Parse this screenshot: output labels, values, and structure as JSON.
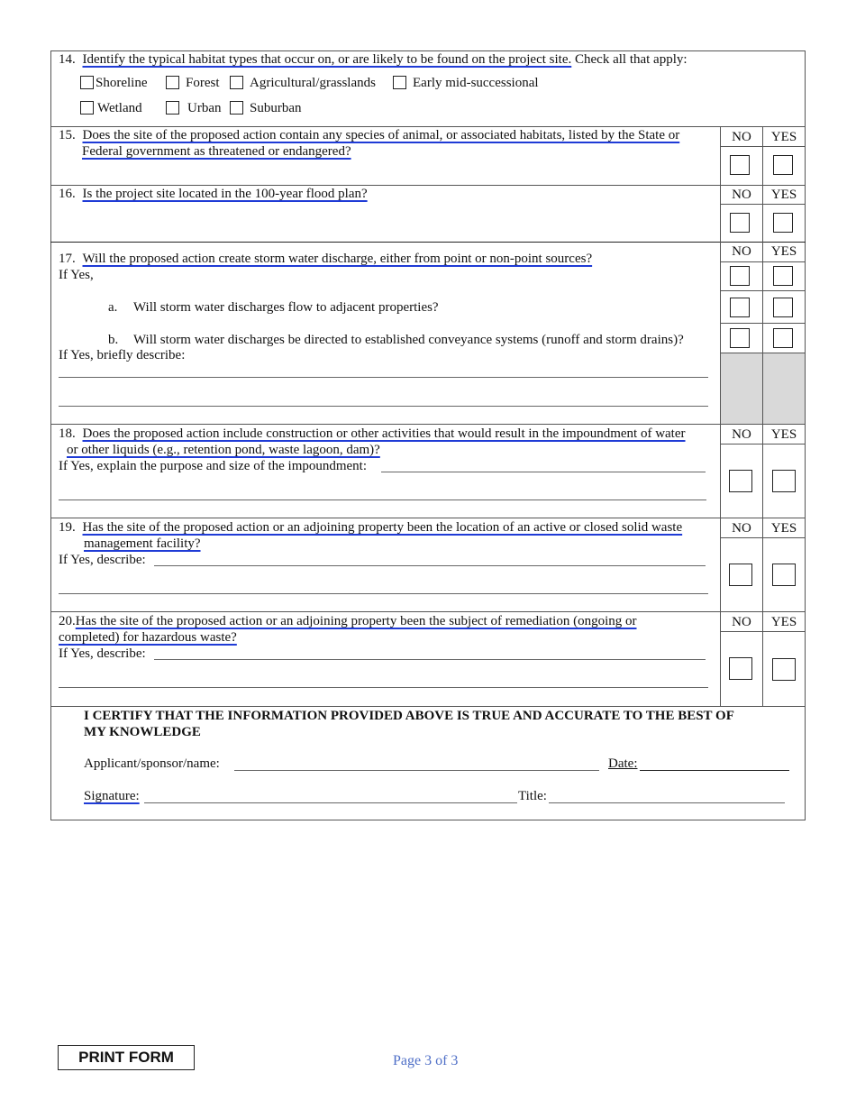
{
  "form": {
    "q14": {
      "number": "14.",
      "text": "Identify the typical habitat types that occur on, or are likely to be found on the project site.",
      "suffix": " Check all that apply:",
      "options": [
        "Shoreline",
        "Forest",
        "Agricultural/grasslands",
        "Early mid-successional",
        "Wetland",
        "Urban",
        "Suburban"
      ]
    },
    "columns": {
      "no": "NO",
      "yes": "YES"
    },
    "q15": {
      "number": "15.",
      "line1": "Does the site of the proposed action contain any species of animal, or associated habitats, listed by the State or",
      "line2": "Federal government as threatened or endangered?"
    },
    "q16": {
      "number": "16.",
      "text": "Is the project site located in the 100-year flood plan?"
    },
    "q17": {
      "number": "17.",
      "text": "Will the proposed action create storm water discharge, either from point or non-point sources?",
      "if_yes": "If Yes,",
      "a_label": "a.",
      "a_text": "Will storm water discharges flow to adjacent properties?",
      "b_label": "b.",
      "b_text": "Will storm water discharges be directed to established conveyance systems (runoff and storm drains)?",
      "describe": "If Yes, briefly describe:"
    },
    "q18": {
      "number": "18.",
      "line1": "Does the proposed action include construction or other activities that would result in the impoundment of water",
      "line2": "or other liquids (e.g., retention pond, waste lagoon, dam)?",
      "explain": "If Yes, explain the purpose and size of the impoundment:"
    },
    "q19": {
      "number": "19.",
      "line1": "Has the site of the proposed action or an adjoining property been the location of an active or closed solid waste",
      "line2": "management facility?",
      "describe": "If Yes, describe:"
    },
    "q20": {
      "number": "20.",
      "line1": "Has the site of the proposed action or an adjoining property been the subject of remediation (ongoing or",
      "line2": "completed) for hazardous waste?",
      "describe": "If Yes, describe:"
    },
    "certify": {
      "line1": "I CERTIFY THAT THE INFORMATION PROVIDED ABOVE IS TRUE AND ACCURATE TO THE BEST OF",
      "line2": "MY KNOWLEDGE",
      "applicant_label": "Applicant/sponsor/name:",
      "applicant_value": "",
      "date_label": "Date:",
      "date_value": "",
      "signature_label": "Signature:",
      "signature_value": "",
      "title_label": "Title:",
      "title_value": ""
    }
  },
  "footer": {
    "print_button": "PRINT FORM",
    "page_label": "Page 3 of 3"
  }
}
